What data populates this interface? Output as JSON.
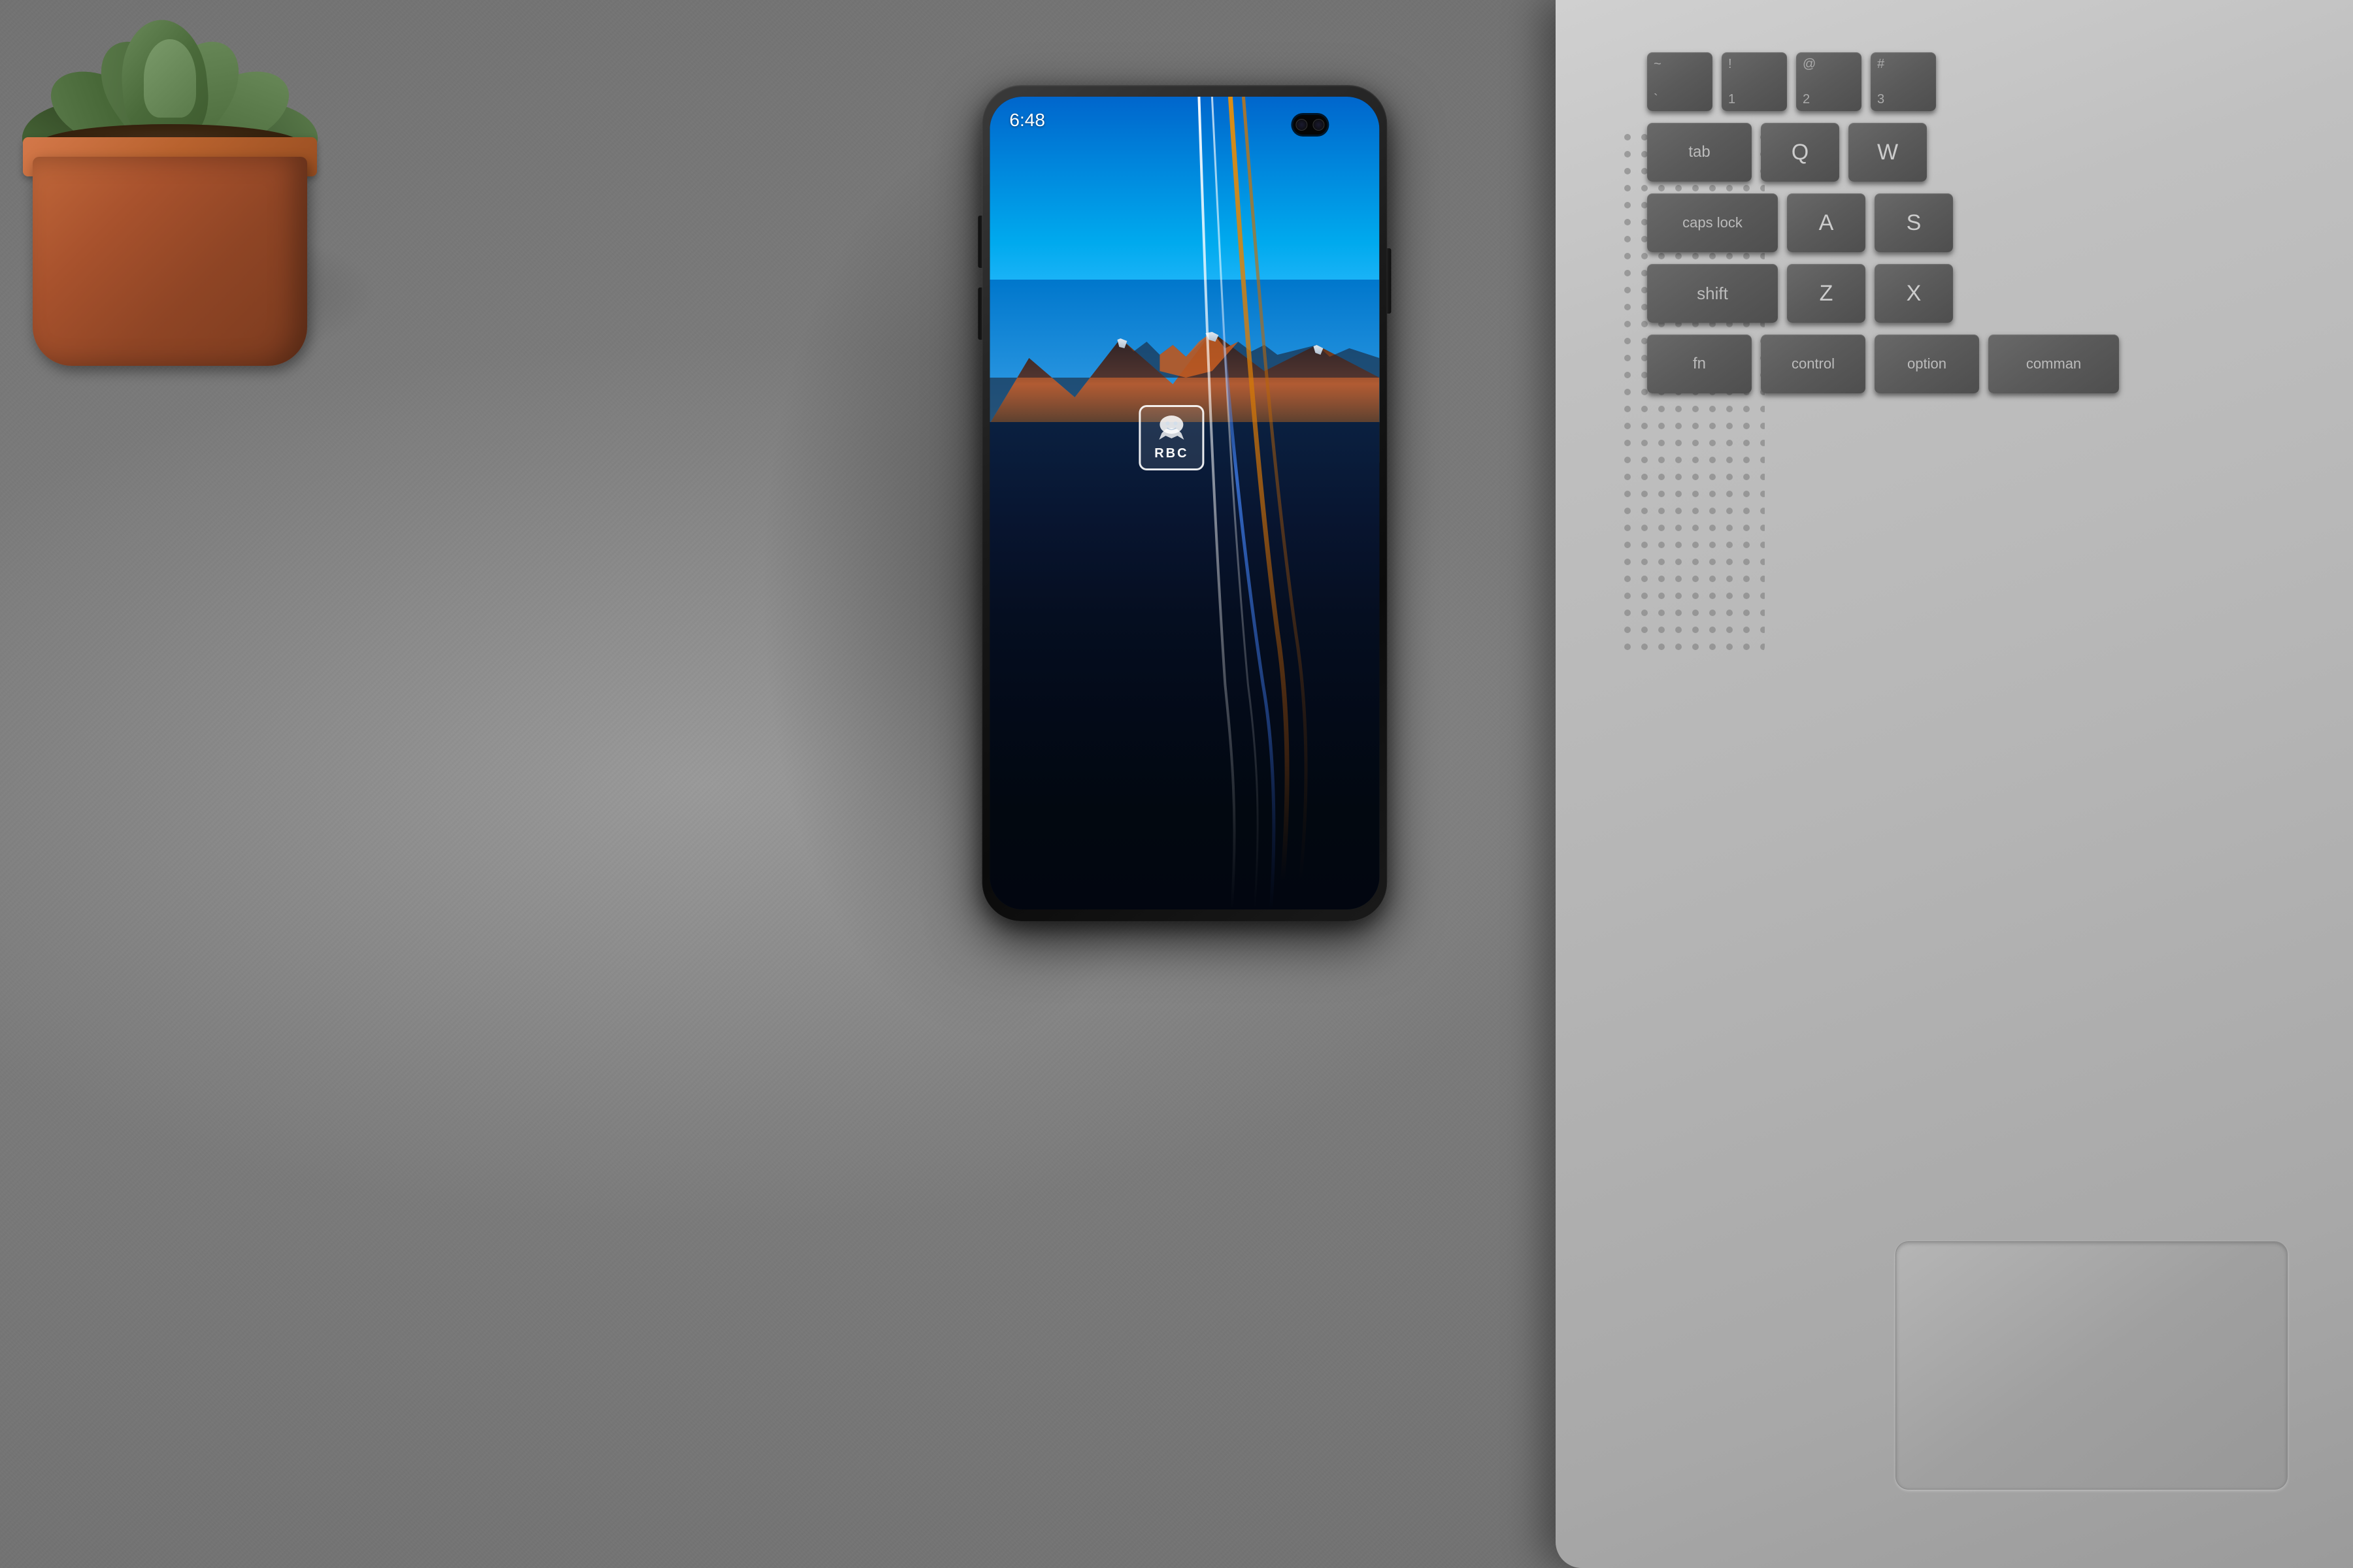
{
  "scene": {
    "description": "Flat lay desk scene with smartphone, succulent plant, and laptop keyboard"
  },
  "phone": {
    "time": "6:48",
    "brand": "RBC",
    "screen_description": "Mountain lake wallpaper with RBC branding and decorative lines"
  },
  "laptop": {
    "keyboard": {
      "row1": {
        "keys": [
          "~\n`",
          "!\n1",
          "@\n2",
          "#\n3"
        ]
      },
      "row2": {
        "modifier": "tab",
        "keys": [
          "Q",
          "W"
        ]
      },
      "row3": {
        "modifier": "caps lock",
        "keys": [
          "A",
          "S"
        ]
      },
      "row4": {
        "modifier": "shift",
        "keys": [
          "Z",
          "X"
        ]
      },
      "row5": {
        "keys": [
          "fn",
          "control",
          "option",
          "command"
        ]
      }
    }
  },
  "plant": {
    "type": "succulent",
    "pot_color": "#c1673a"
  },
  "keyboard_keys": [
    {
      "label": "~",
      "sublabel": "`",
      "row": 1
    },
    {
      "label": "!",
      "sublabel": "1",
      "row": 1
    },
    {
      "label": "@",
      "sublabel": "2",
      "row": 1
    },
    {
      "label": "#",
      "sublabel": "3",
      "row": 1
    },
    {
      "label": "tab",
      "row": 2
    },
    {
      "label": "Q",
      "row": 2
    },
    {
      "label": "W",
      "row": 2
    },
    {
      "label": "caps lock",
      "row": 3
    },
    {
      "label": "A",
      "row": 3
    },
    {
      "label": "S",
      "row": 3
    },
    {
      "label": "shift",
      "row": 4
    },
    {
      "label": "Z",
      "row": 4
    },
    {
      "label": "X",
      "row": 4
    },
    {
      "label": "fn",
      "row": 5
    },
    {
      "label": "control",
      "row": 5
    },
    {
      "label": "option",
      "row": 5
    },
    {
      "label": "command",
      "row": 5
    }
  ]
}
